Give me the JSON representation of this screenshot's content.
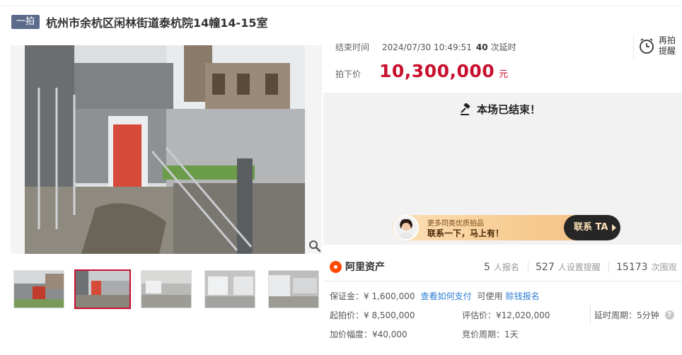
{
  "header": {
    "badge": "一拍",
    "title": "杭州市余杭区闲林街道泰杭院14幢14-15室"
  },
  "auction": {
    "end_time_label": "结束时间",
    "end_time": "2024/07/30 10:49:51",
    "delay_count": "40",
    "delay_label": "次延时",
    "price_label": "拍下价",
    "price": "10,300,000",
    "price_unit": "元",
    "remind_label": "再拍提醒",
    "ended_text": "本场已结束！"
  },
  "banner": {
    "line1": "更多同类优质拍品",
    "line2": "联系一下，马上有！",
    "button": "联系 TA"
  },
  "platform": {
    "name": "阿里资产"
  },
  "stats": [
    {
      "value": "5",
      "label": "人报名"
    },
    {
      "value": "527",
      "label": "人设置提醒"
    },
    {
      "value": "15173",
      "label": "次围观"
    }
  ],
  "deposit": {
    "text": "保证金：¥ 1,600,000",
    "link": "查看如何支付",
    "use_text": "可使用",
    "use_link": "赊钱报名"
  },
  "details": {
    "start_price": "起拍价：¥ 8,500,000",
    "assessed": "评估价：¥12,020,000",
    "delay_period": "延时周期：5分钟",
    "increment": "加价幅度：¥40,000",
    "bid_period": "竞价周期：1天"
  },
  "colors": {
    "accent_red": "#c8102e",
    "link_blue": "#2b7cd3",
    "badge_bg": "#5b6b8c"
  }
}
